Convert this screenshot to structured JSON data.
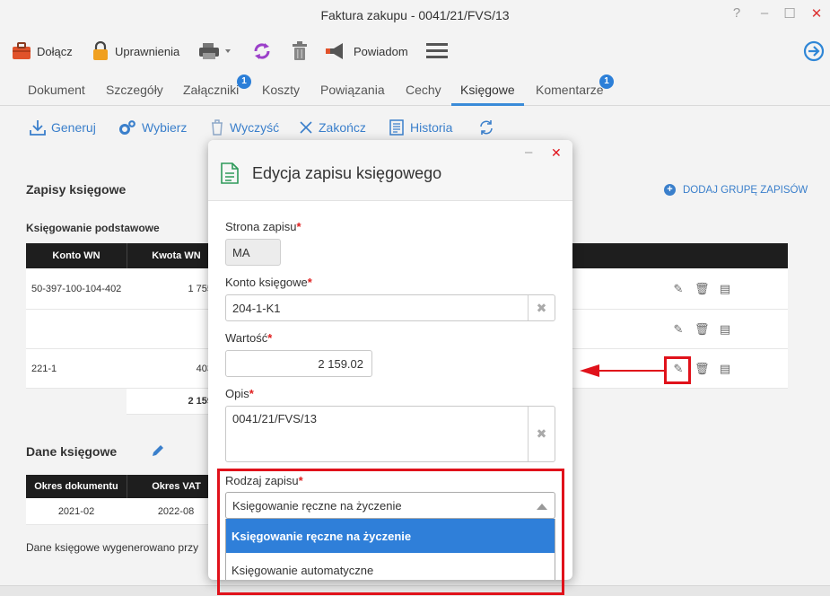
{
  "window": {
    "title": "Faktura zakupu - 0041/21/FVS/13",
    "help_symbol": "?",
    "minimize_symbol": "–",
    "maximize_symbol": "☐",
    "close_symbol": "✕"
  },
  "toolbar": {
    "attach_label": "Dołącz",
    "permissions_label": "Uprawnienia",
    "notify_label": "Powiadom"
  },
  "tabs": {
    "items": [
      {
        "label": "Dokument"
      },
      {
        "label": "Szczegóły"
      },
      {
        "label": "Załączniki",
        "badge": "1"
      },
      {
        "label": "Koszty"
      },
      {
        "label": "Powiązania"
      },
      {
        "label": "Cechy"
      },
      {
        "label": "Księgowe",
        "active": true
      },
      {
        "label": "Komentarze",
        "badge": "1"
      }
    ]
  },
  "actions": {
    "generate": "Generuj",
    "choose": "Wybierz",
    "clear": "Wyczyść",
    "finish": "Zakończ",
    "history": "Historia"
  },
  "entries": {
    "title": "Zapisy księgowe",
    "add_group_label": "DODAJ GRUPĘ ZAPISÓW",
    "basic_label": "Księgowanie podstawowe",
    "columns": [
      "Konto WN",
      "Kwota WN"
    ],
    "rows": [
      {
        "account": "50-397-100-104-402",
        "amount": "1 755"
      },
      {
        "account": "",
        "amount": ""
      },
      {
        "account": "221-1",
        "amount": "403"
      }
    ],
    "total": "2 159"
  },
  "accounting_data": {
    "title": "Dane księgowe",
    "columns": [
      "Okres dokumentu",
      "Okres VAT"
    ],
    "row": [
      "2021-02",
      "2022-08"
    ],
    "footer": "Dane księgowe wygenerowano przy"
  },
  "dialog": {
    "title": "Edycja zapisu księgowego",
    "minimize_symbol": "–",
    "close_symbol": "✕",
    "side": {
      "label": "Strona zapisu",
      "value": "MA"
    },
    "account": {
      "label": "Konto księgowe",
      "value": "204-1-K1"
    },
    "value": {
      "label": "Wartość",
      "value": "2 159.02"
    },
    "description": {
      "label": "Opis",
      "value": "0041/21/FVS/13"
    },
    "kind": {
      "label": "Rodzaj zapisu",
      "value": "Księgowanie ręczne na życzenie",
      "options": [
        {
          "label": "Księgowanie ręczne na życzenie",
          "selected": true
        },
        {
          "label": "Księgowanie automatyczne",
          "selected": false
        }
      ]
    },
    "required_mark": "*",
    "clear_symbol": "✖"
  },
  "colors": {
    "accent": "#3a7fcb",
    "highlight": "#e0121b",
    "selected_option": "#2f7fd9",
    "table_header": "#1e1e1e"
  }
}
